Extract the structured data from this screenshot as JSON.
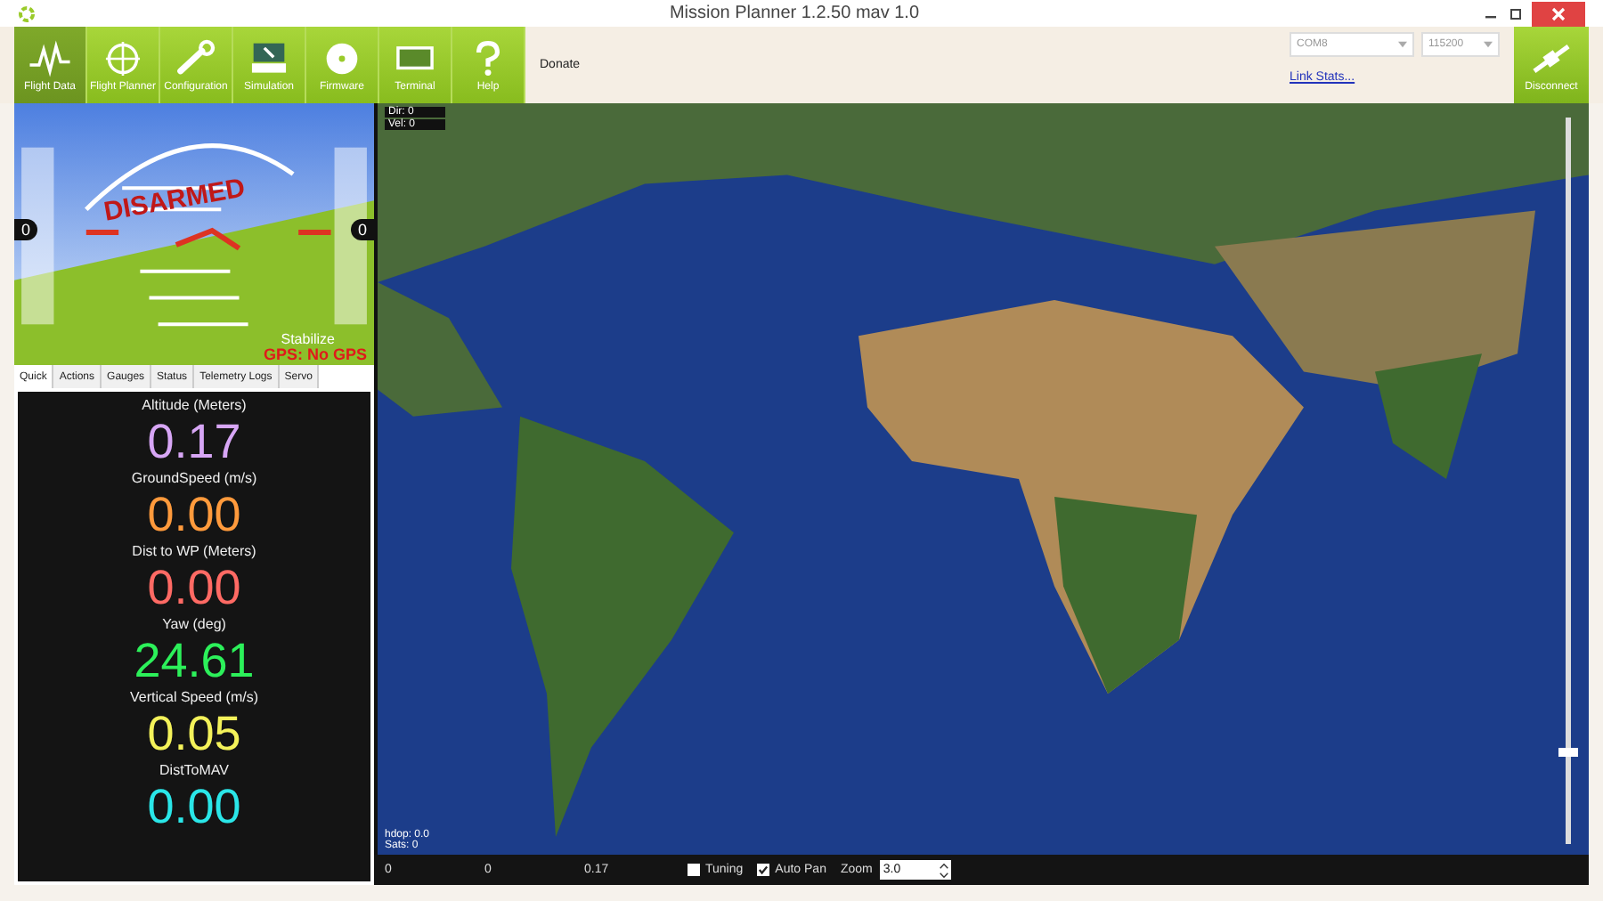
{
  "window": {
    "title": "Mission Planner 1.2.50 mav 1.0"
  },
  "toolbar": {
    "buttons": [
      {
        "label": "Flight Data",
        "kind": "wave",
        "selected": true
      },
      {
        "label": "Flight Planner",
        "kind": "crosshair",
        "selected": false
      },
      {
        "label": "Configuration",
        "kind": "wrench",
        "selected": false
      },
      {
        "label": "Simulation",
        "kind": "screen",
        "selected": false
      },
      {
        "label": "Firmware",
        "kind": "disc",
        "selected": false
      },
      {
        "label": "Terminal",
        "kind": "monitor",
        "selected": false
      },
      {
        "label": "Help",
        "kind": "question",
        "selected": false
      }
    ],
    "donate": "Donate"
  },
  "connection": {
    "port": "COM8",
    "baud": "115200",
    "link_stats": "Link Stats...",
    "disconnect": "Disconnect"
  },
  "hud": {
    "armed_text": "DISARMED",
    "mode": "Stabilize",
    "gps": "GPS: No GPS",
    "altitude_box": "0",
    "speed_box": "0"
  },
  "tabs": [
    {
      "label": "Quick",
      "selected": true
    },
    {
      "label": "Actions",
      "selected": false
    },
    {
      "label": "Gauges",
      "selected": false
    },
    {
      "label": "Status",
      "selected": false
    },
    {
      "label": "Telemetry Logs",
      "selected": false
    },
    {
      "label": "Servo",
      "selected": false
    }
  ],
  "quick": [
    {
      "label": "Altitude (Meters)",
      "value": "0.17",
      "color": "#d7a6f5"
    },
    {
      "label": "GroundSpeed (m/s)",
      "value": "0.00",
      "color": "#ff9a3c"
    },
    {
      "label": "Dist to WP (Meters)",
      "value": "0.00",
      "color": "#ff6a64"
    },
    {
      "label": "Yaw (deg)",
      "value": "24.61",
      "color": "#2cf05a"
    },
    {
      "label": "Vertical Speed (m/s)",
      "value": "0.05",
      "color": "#f4f25a"
    },
    {
      "label": "DistToMAV",
      "value": "0.00",
      "color": "#2ae6e8"
    }
  ],
  "map": {
    "overlays_top": [
      "Dir: 0",
      "Vel: 0"
    ],
    "overlays_bottom": [
      "hdop: 0.0",
      "Sats: 0"
    ],
    "zoom_slider": {
      "level": 0.12
    }
  },
  "bottom_bar": {
    "readings": [
      "0",
      "0",
      "0.17"
    ],
    "checkboxes": [
      {
        "label": "Tuning",
        "checked": false
      },
      {
        "label": "Auto Pan",
        "checked": true
      }
    ],
    "zoom_label": "Zoom",
    "zoom_value": "3.0"
  }
}
